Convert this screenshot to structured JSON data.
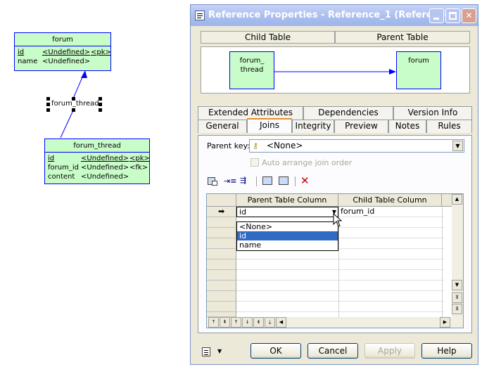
{
  "diagram": {
    "forum": {
      "name": "forum",
      "rows": [
        {
          "col": "id",
          "type": "<Undefined>",
          "key": "<pk>"
        },
        {
          "col": "name",
          "type": "<Undefined>",
          "key": ""
        }
      ]
    },
    "reference_label": "forum_thread",
    "forum_thread": {
      "name": "forum_thread",
      "rows": [
        {
          "col": "id",
          "type": "<Undefined>",
          "key": "<pk>"
        },
        {
          "col": "forum_id",
          "type": "<Undefined>",
          "key": "<fk>"
        },
        {
          "col": "content",
          "type": "<Undefined>",
          "key": ""
        }
      ]
    }
  },
  "dialog": {
    "title": "Reference Properties - Reference_1 (Reference...",
    "child_table_label": "Child Table",
    "parent_table_label": "Parent Table",
    "preview_child_line1": "forum_",
    "preview_child_line2": "thread",
    "preview_parent": "forum",
    "tabs_row1": [
      "Extended Attributes",
      "Dependencies",
      "Version Info"
    ],
    "tabs_row2": [
      "General",
      "Joins",
      "Integrity",
      "Preview",
      "Notes",
      "Rules"
    ],
    "active_tab": "Joins",
    "parent_key_label": "Parent key:",
    "parent_key_value": "<None>",
    "auto_arrange_label": "Auto arrange join order",
    "grid": {
      "col1": "Parent Table Column",
      "col2": "Child Table Column",
      "row1_parent": "id",
      "row1_child": "forum_id"
    },
    "dropdown_options": [
      "<None>",
      "id",
      "name"
    ],
    "dropdown_selected": "id",
    "buttons": {
      "ok": "OK",
      "cancel": "Cancel",
      "apply": "Apply",
      "help": "Help"
    }
  },
  "colors": {
    "entity_fill": "#c8fcc8",
    "entity_border": "#0000ff",
    "selection": "#316ac5"
  }
}
